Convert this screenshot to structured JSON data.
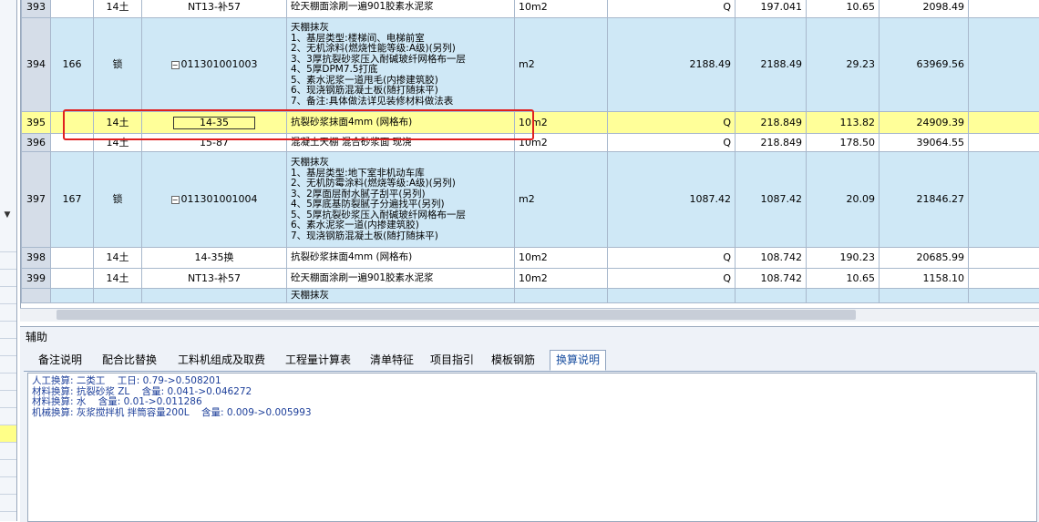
{
  "rows": [
    {
      "num": "393",
      "seq": "",
      "type": "14土",
      "code": "NT13-补57",
      "expand": false,
      "desc": [
        "砼天棚面涂刷一遍901胶素水泥浆"
      ],
      "unit": "10m2",
      "qty_expr": "Q",
      "qty": "197.041",
      "price": "10.65",
      "total": "2098.49",
      "extra": "",
      "style": "white"
    },
    {
      "num": "394",
      "seq": "166",
      "type": "锁",
      "code": "011301001003",
      "expand": true,
      "desc": [
        "天棚抹灰",
        "1、基层类型:楼梯间、电梯前室",
        "2、无机涂料(燃烧性能等级:A级)(另列)",
        "3、3厚抗裂砂浆压入耐碱玻纤网格布一层",
        "4、5厚DPM7.5打底",
        "5、素水泥浆一道甩毛(内掺建筑胶)",
        "6、现浇钢筋混凝土板(随打随抹平)",
        "7、备注:具体做法详见装修材料做法表"
      ],
      "unit": "m2",
      "qty_expr": "2188.49",
      "qty": "2188.49",
      "price": "29.23",
      "total": "63969.56",
      "extra": "0",
      "style": "blue"
    },
    {
      "num": "395",
      "seq": "",
      "type": "14土",
      "code": "14-35",
      "expand": false,
      "desc": [
        "抗裂砂浆抹面4mm (网格布)"
      ],
      "unit": "10m2",
      "qty_expr": "Q",
      "qty": "218.849",
      "price": "113.82",
      "total": "24909.39",
      "extra": "0",
      "style": "yellow"
    },
    {
      "num": "396",
      "seq": "",
      "type": "14土",
      "code": "15-87",
      "expand": false,
      "desc": [
        "混凝土天棚 混合砂浆面 现浇"
      ],
      "unit": "10m2",
      "qty_expr": "Q",
      "qty": "218.849",
      "price": "178.50",
      "total": "39064.55",
      "extra": "0",
      "style": "white"
    },
    {
      "num": "397",
      "seq": "167",
      "type": "锁",
      "code": "011301001004",
      "expand": true,
      "desc": [
        "天棚抹灰",
        "1、基层类型:地下室非机动车库",
        "2、无机防霉涂料(燃烧等级:A级)(另列)",
        "3、2厚面层耐水腻子刮平(另列)",
        "4、5厚底基防裂腻子分遍找平(另列)",
        "5、5厚抗裂砂浆压入耐碱玻纤网格布一层",
        "6、素水泥浆一道(内掺建筑胶)",
        "7、现浇钢筋混凝土板(随打随抹平)"
      ],
      "unit": "m2",
      "qty_expr": "1087.42",
      "qty": "1087.42",
      "price": "20.09",
      "total": "21846.27",
      "extra": "0",
      "style": "blue"
    },
    {
      "num": "398",
      "seq": "",
      "type": "14土",
      "code": "14-35换",
      "expand": false,
      "desc": [
        "抗裂砂浆抹面4mm (网格布)"
      ],
      "unit": "10m2",
      "qty_expr": "Q",
      "qty": "108.742",
      "price": "190.23",
      "total": "20685.99",
      "extra": "0",
      "style": "white"
    },
    {
      "num": "399",
      "seq": "",
      "type": "14土",
      "code": "NT13-补57",
      "expand": false,
      "desc": [
        "砼天棚面涂刷一遍901胶素水泥浆"
      ],
      "unit": "10m2",
      "qty_expr": "Q",
      "qty": "108.742",
      "price": "10.65",
      "total": "1158.10",
      "extra": "0",
      "style": "white"
    },
    {
      "num": "",
      "seq": "",
      "type": "",
      "code": "",
      "expand": false,
      "desc": [
        "天棚抹灰"
      ],
      "unit": "",
      "qty_expr": "",
      "qty": "",
      "price": "",
      "total": "",
      "extra": "",
      "style": "blue"
    }
  ],
  "aux": {
    "title": "辅助",
    "tabs": [
      "备注说明",
      "配合比替换",
      "工料机组成及取费",
      "工程量计算表",
      "清单特征",
      "项目指引",
      "模板钢筋",
      "换算说明"
    ],
    "active_tab": 7,
    "notes": [
      "人工换算: 二类工    工日: 0.79->0.508201",
      "材料换算: 抗裂砂浆 ZL    含量: 0.041->0.046272",
      "材料换算: 水    含量: 0.01->0.011286",
      "机械换算: 灰浆搅拌机 拌筒容量200L    含量: 0.009->0.005993"
    ]
  },
  "icons": {
    "gutter_arrow": "chevron-down-icon",
    "expand": "collapse-minus-icon"
  }
}
